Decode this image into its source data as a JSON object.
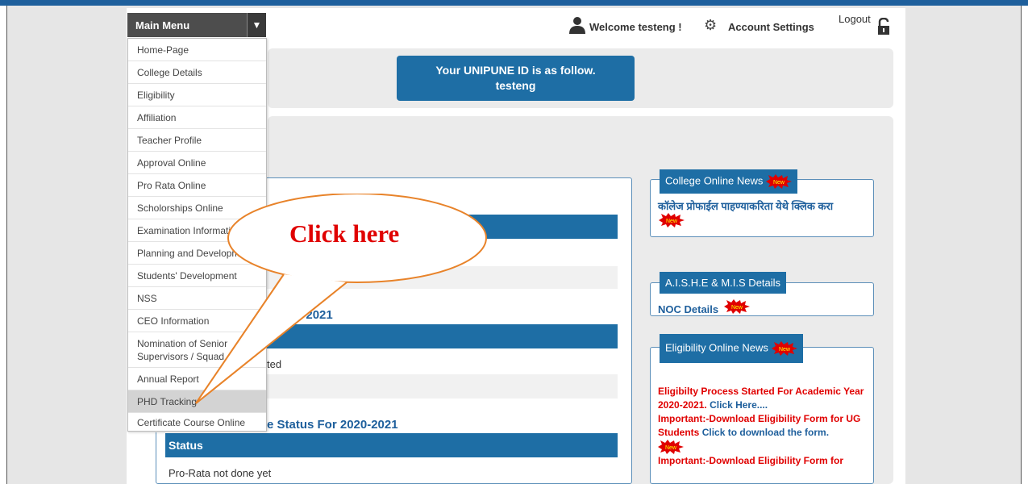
{
  "header": {
    "menu_label": "Main Menu",
    "menu_arrow": "▼",
    "welcome": "Welcome testeng !",
    "account_settings": "Account Settings",
    "logout": "Logout"
  },
  "id_box": {
    "line1": "Your UNIPUNE ID is as follow.",
    "line2": "testeng"
  },
  "menu_items": [
    "Home-Page",
    "College Details",
    "Eligibility",
    "Affiliation",
    "Teacher Profile",
    "Approval Online",
    "Pro Rata Online",
    "Scholorships Online",
    "Examination Information",
    "Planning and Development",
    "Students' Development",
    "NSS",
    "CEO Information",
    "Nomination of Senior Supervisors / Squad",
    "Annual Report",
    "PHD Tracking",
    "Certificate Course Online"
  ],
  "highlighted_item": "PHD Tracking",
  "callout": {
    "text": "Click here"
  },
  "main": {
    "section1_title": "r 2020-2021",
    "section1_cell": "ted",
    "section2_title": "e Status For 2020-2021",
    "status_header": "Status",
    "status_value": "Pro-Rata not done yet",
    "partial_heading": "..."
  },
  "news": {
    "college": {
      "title": "College Online News",
      "link": "कॉलेज प्रोफाईल पाहण्याकरिता येथे क्लिक करा"
    },
    "aishe": {
      "title": "A.I.S.H.E & M.I.S Details",
      "link": "NOC Details"
    },
    "eligibility": {
      "title": "Eligibility Online News",
      "item1_red": "Eligibilty Process Started For Academic Year 2020-2021.",
      "item1_blue": "Click Here....",
      "item2_red": "Important:-Download Eligibility Form for UG Students",
      "item2_blue": "Click to download the form.",
      "item3_red": "Important:-Download Eligibility Form for"
    }
  },
  "badge_text": "New",
  "colors": {
    "primary": "#1e6ea5",
    "menu": "#4d4d4d",
    "alert": "#e00000",
    "callout_stroke": "#e8832a"
  }
}
